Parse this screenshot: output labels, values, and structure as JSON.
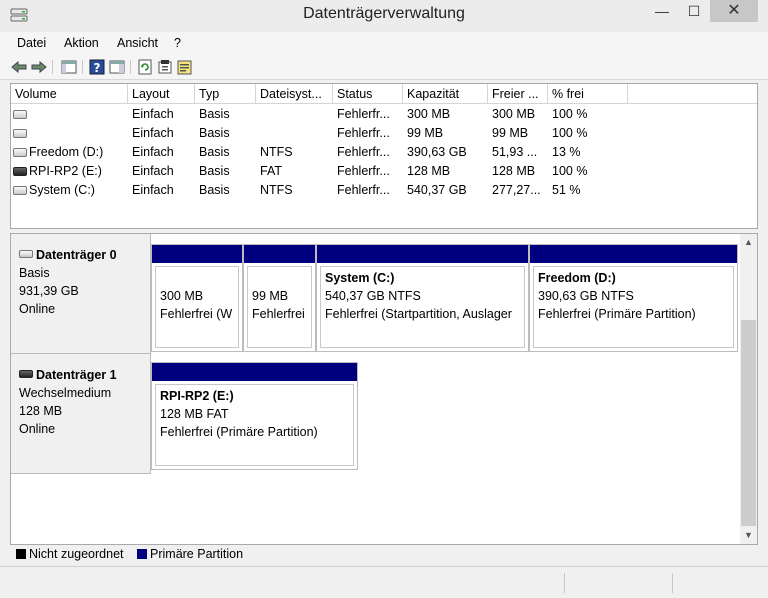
{
  "window": {
    "title": "Datenträgerverwaltung",
    "minimize_glyph": "—",
    "maximize_glyph": "☐",
    "close_glyph": "✕"
  },
  "menu": [
    "Datei",
    "Aktion",
    "Ansicht",
    "?"
  ],
  "toolbar": {
    "icons": [
      "back-arrow-icon",
      "forward-arrow-icon",
      "console-tree-icon",
      "help-icon",
      "properties-panel-icon",
      "refresh-icon",
      "settings-icon",
      "export-icon"
    ]
  },
  "volume_table": {
    "columns": [
      "Volume",
      "Layout",
      "Typ",
      "Dateisyst...",
      "Status",
      "Kapazität",
      "Freier ...",
      "% frei"
    ],
    "rows": [
      {
        "volume": "",
        "layout": "Einfach",
        "typ": "Basis",
        "fs": "",
        "status": "Fehlerfr...",
        "capacity": "300 MB",
        "free": "300 MB",
        "pct": "100 %",
        "icon": "hdd"
      },
      {
        "volume": "",
        "layout": "Einfach",
        "typ": "Basis",
        "fs": "",
        "status": "Fehlerfr...",
        "capacity": "99 MB",
        "free": "99 MB",
        "pct": "100 %",
        "icon": "hdd"
      },
      {
        "volume": "Freedom (D:)",
        "layout": "Einfach",
        "typ": "Basis",
        "fs": "NTFS",
        "status": "Fehlerfr...",
        "capacity": "390,63 GB",
        "free": "51,93 ...",
        "pct": "13 %",
        "icon": "hdd"
      },
      {
        "volume": "RPI-RP2 (E:)",
        "layout": "Einfach",
        "typ": "Basis",
        "fs": "FAT",
        "status": "Fehlerfr...",
        "capacity": "128 MB",
        "free": "128 MB",
        "pct": "100 %",
        "icon": "removable"
      },
      {
        "volume": "System (C:)",
        "layout": "Einfach",
        "typ": "Basis",
        "fs": "NTFS",
        "status": "Fehlerfr...",
        "capacity": "540,37 GB",
        "free": "277,27...",
        "pct": "51 %",
        "icon": "hdd"
      }
    ]
  },
  "disks": [
    {
      "name": "Datenträger 0",
      "type": "Basis",
      "size": "931,39 GB",
      "state": "Online",
      "partitions": [
        {
          "title": "",
          "line1": "300 MB",
          "line2": "Fehlerfrei (W"
        },
        {
          "title": "",
          "line1": "99 MB",
          "line2": "Fehlerfrei"
        },
        {
          "title": "System  (C:)",
          "line1": "540,37 GB NTFS",
          "line2": "Fehlerfrei (Startpartition, Auslager"
        },
        {
          "title": "Freedom  (D:)",
          "line1": "390,63 GB NTFS",
          "line2": "Fehlerfrei (Primäre Partition)"
        }
      ]
    },
    {
      "name": "Datenträger 1",
      "type": "Wechselmedium",
      "size": "128 MB",
      "state": "Online",
      "partitions": [
        {
          "title": "RPI-RP2  (E:)",
          "line1": "128 MB FAT",
          "line2": "Fehlerfrei (Primäre Partition)"
        }
      ]
    }
  ],
  "legend": [
    {
      "label": "Nicht zugeordnet",
      "color": "#000000"
    },
    {
      "label": "Primäre Partition",
      "color": "#00007f"
    }
  ],
  "colors": {
    "primary_partition": "#00007f",
    "unallocated": "#000000"
  }
}
